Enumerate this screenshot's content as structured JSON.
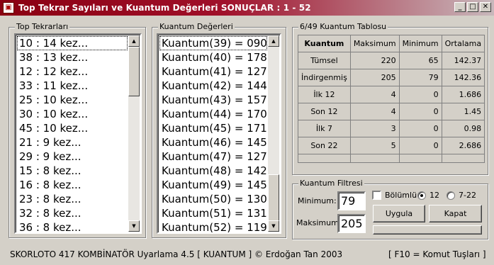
{
  "window": {
    "title": "Top Tekrar Sayıları ve Kuantum Değerleri   SONUÇLAR : 1 - 52",
    "minimize": "_",
    "maximize": "□",
    "close": "✕"
  },
  "top_tekrar": {
    "legend": "Top Tekrarları",
    "items": [
      "10 :  14 kez...",
      "38 :  13 kez...",
      "12 :  12 kez...",
      "33 :  11 kez...",
      "25 :  10 kez...",
      "30 :  10 kez...",
      "45 :  10 kez...",
      "21 :  9 kez...",
      "29 :  9 kez...",
      "15 :  8 kez...",
      "16 :  8 kez...",
      "23 :  8 kez...",
      "32 :  8 kez...",
      "36 :  8 kez..."
    ]
  },
  "kuantum": {
    "legend": "Kuantum Değerleri",
    "items": [
      "Kuantum(39) = 090",
      "Kuantum(40) = 178",
      "Kuantum(41) = 127",
      "Kuantum(42) = 144",
      "Kuantum(43) = 157",
      "Kuantum(44) = 170",
      "Kuantum(45) = 171",
      "Kuantum(46) = 145",
      "Kuantum(47) = 127",
      "Kuantum(48) = 142",
      "Kuantum(49) = 145",
      "Kuantum(50) = 130",
      "Kuantum(51) = 131",
      "Kuantum(52) = 119"
    ]
  },
  "tablo": {
    "legend": "6/49 Kuantum Tablosu",
    "headers": [
      "Kuantum",
      "Maksimum",
      "Minimum",
      "Ortalama"
    ],
    "rows": [
      [
        "Tümsel",
        "220",
        "65",
        "142.37"
      ],
      [
        "İndirgenmiş",
        "205",
        "79",
        "142.36"
      ],
      [
        "İlk 12",
        "4",
        "0",
        "1.686"
      ],
      [
        "Son 12",
        "4",
        "0",
        "1.45"
      ],
      [
        "İlk 7",
        "3",
        "0",
        "0.98"
      ],
      [
        "Son 22",
        "5",
        "0",
        "2.686"
      ]
    ]
  },
  "filtre": {
    "legend": "Kuantum Filtresi",
    "minimum_label": "Minimum:",
    "minimum_value": "79",
    "maksimum_label": "Maksimum:",
    "maksimum_value": "205",
    "bolumlu_label": "Bölümlü :",
    "radio_12": "12",
    "radio_722": "7-22",
    "uygula": "Uygula",
    "kapat": "Kapat"
  },
  "status": {
    "left": "SKORLOTO 417 KOMBİNATÖR  Uyarlama 4.5   [  KUANTUM  ]   © Erdoğan Tan  2003",
    "right": "[ F10 = Komut Tuşları ]"
  }
}
